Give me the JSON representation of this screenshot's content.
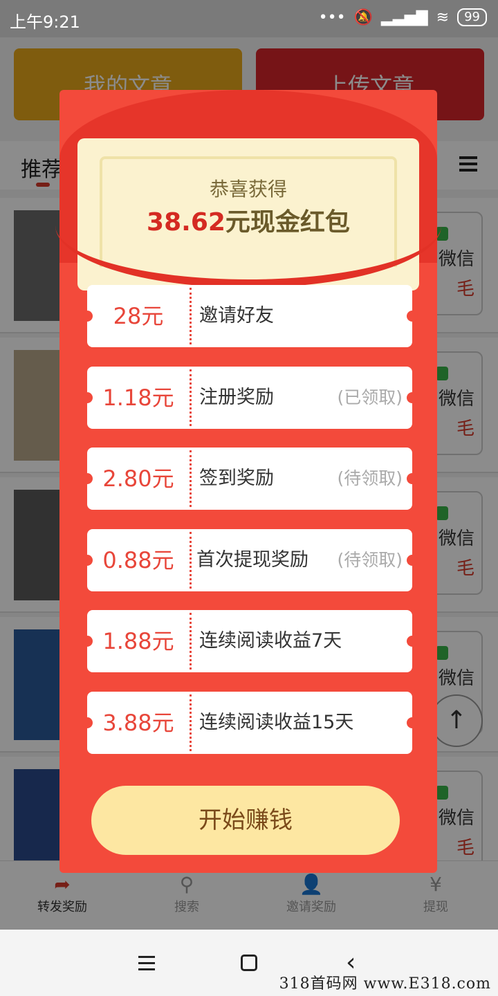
{
  "status": {
    "time": "上午9:21",
    "battery": "99"
  },
  "app": {
    "buttons": {
      "my_articles": "我的文章",
      "upload_article": "上传文章"
    },
    "tabs": {
      "recommended": "推荐"
    },
    "share": {
      "wechat": "微信",
      "mao": "毛"
    }
  },
  "modal": {
    "congrats": "恭喜获得",
    "amount": "38.62",
    "amount_suffix": "元现金红包",
    "rewards": [
      {
        "value": "28元",
        "label": "邀请好友",
        "status": ""
      },
      {
        "value": "1.18元",
        "label": "注册奖励",
        "status": "(已领取)"
      },
      {
        "value": "2.80元",
        "label": "签到奖励",
        "status": "(待领取)"
      },
      {
        "value": "0.88元",
        "label": "首次提现奖励",
        "status": "(待领取)"
      },
      {
        "value": "1.88元",
        "label": "连续阅读收益7天",
        "status": ""
      },
      {
        "value": "3.88元",
        "label": "连续阅读收益15天",
        "status": ""
      }
    ],
    "start_button": "开始赚钱"
  },
  "tabbar": [
    {
      "label": "转发奖励",
      "icon": "share-arrow-icon"
    },
    {
      "label": "搜索",
      "icon": "search-icon"
    },
    {
      "label": "邀请奖励",
      "icon": "add-user-icon"
    },
    {
      "label": "提现",
      "icon": "yuan-icon"
    }
  ],
  "watermark": "318首码网 www.E318.com"
}
